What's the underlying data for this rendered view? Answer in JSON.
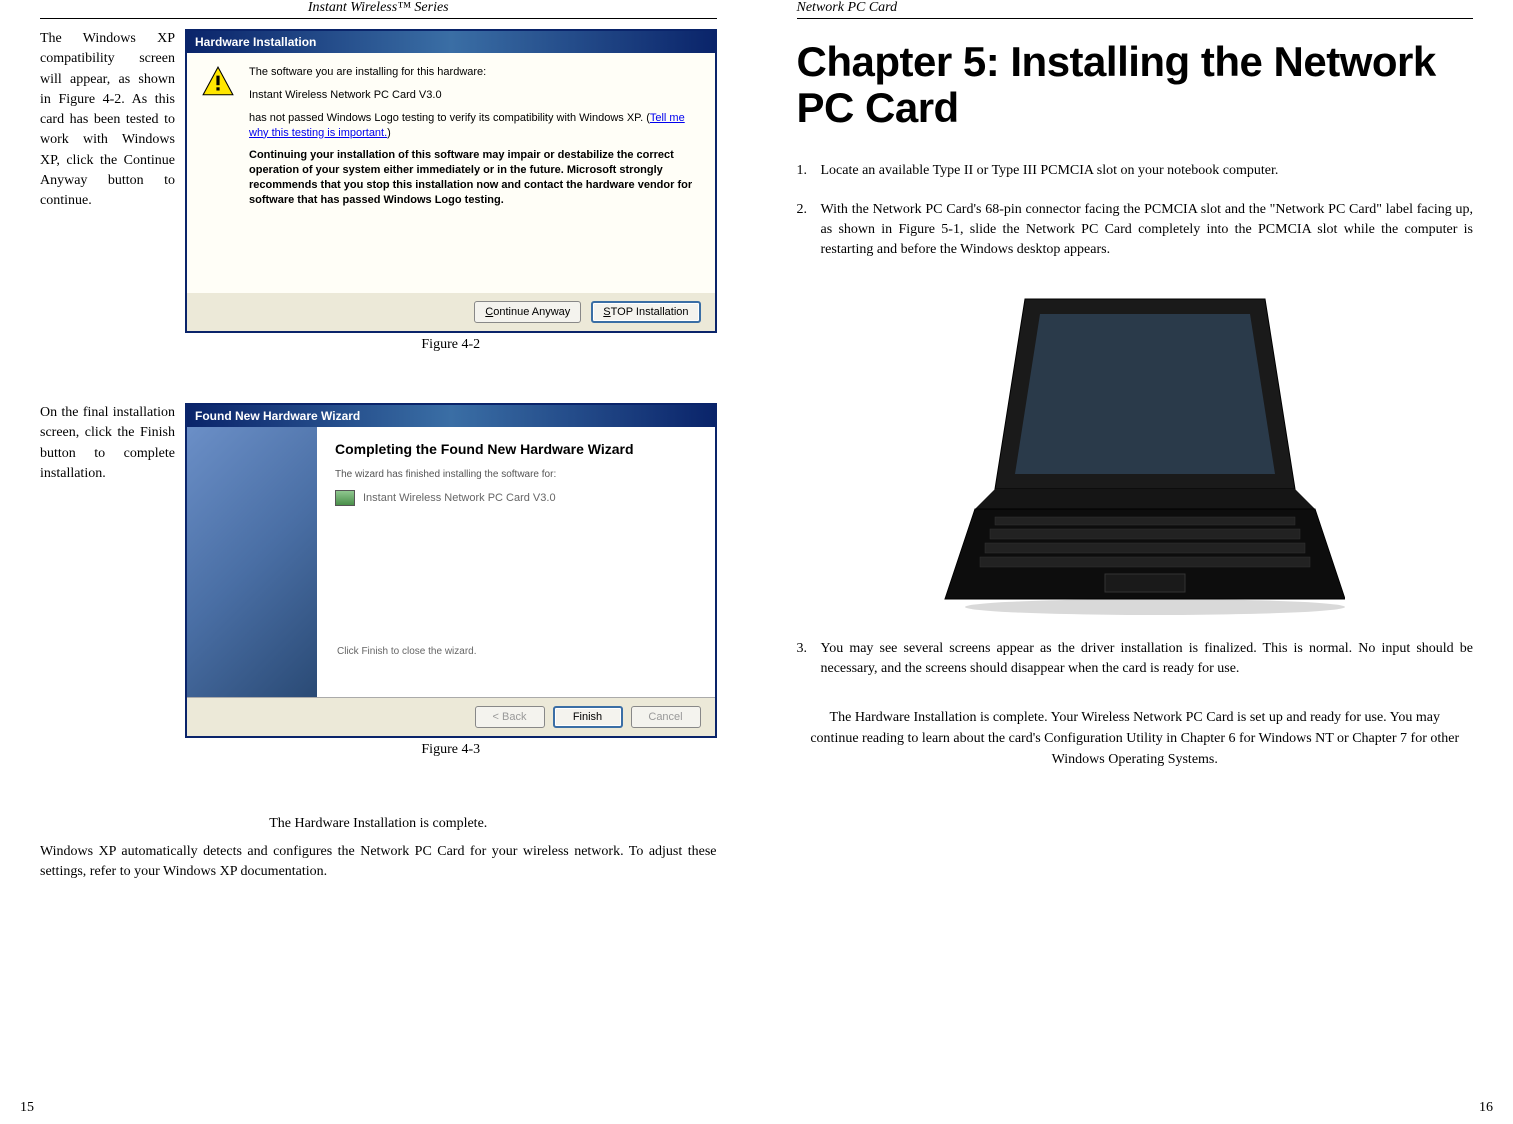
{
  "left_page": {
    "header": "Instant Wireless™ Series",
    "para1": "The Windows XP compatibility screen will appear, as shown in Figure 4-2. As this card has been tested to work with Windows XP, click the Continue Anyway button to continue.",
    "dialog1": {
      "title": "Hardware Installation",
      "line1": "The software you are installing for this hardware:",
      "line2": "Instant Wireless Network PC Card V3.0",
      "line3": "has not passed Windows Logo testing to verify its compatibility with Windows XP. (",
      "link": "Tell me why this testing is important.",
      "line3b": ")",
      "bold": "Continuing your installation of this software may impair or destabilize the correct operation of your system either immediately or in the future. Microsoft strongly recommends that you stop this installation now and contact the hardware vendor for software that has passed Windows Logo testing.",
      "btn_continue": "Continue Anyway",
      "btn_stop": "STOP Installation"
    },
    "fig1_caption": "Figure 4-2",
    "para2": "On the final installation screen, click the Finish button to complete installation.",
    "dialog2": {
      "title": "Found New Hardware Wizard",
      "heading": "Completing the Found New Hardware Wizard",
      "sub": "The wizard has finished installing the software for:",
      "device": "Instant Wireless Network PC Card V3.0",
      "close_text": "Click Finish to close the wizard.",
      "btn_back": "< Back",
      "btn_finish": "Finish",
      "btn_cancel": "Cancel"
    },
    "fig2_caption": "Figure 4-3",
    "para3": "The Hardware Installation is complete.",
    "para4": "Windows XP automatically detects and configures the Network PC Card for your wireless network. To adjust these settings, refer to your Windows XP documentation.",
    "page_num": "15"
  },
  "right_page": {
    "header": "Network PC Card",
    "chapter_title": "Chapter 5: Installing the Network PC Card",
    "item1": "Locate an available Type II or Type III PCMCIA slot on your notebook computer.",
    "item2": "With the Network PC Card's 68-pin connector facing the PCMCIA slot and the \"Network PC Card\" label facing up, as shown in Figure 5-1, slide the Network PC Card completely into the PCMCIA slot while the computer is restarting and before the Windows desktop appears.",
    "item3": "You may see several screens appear as the driver installation is finalized. This is normal.  No input should be necessary, and the screens should disappear when the card is ready for use.",
    "closing": "The Hardware Installation is complete.  Your Wireless Network PC Card is set up and ready for use.  You may continue reading to learn about the card's Configuration Utility in Chapter 6 for Windows NT or Chapter 7 for other Windows Operating Systems.",
    "page_num": "16"
  }
}
